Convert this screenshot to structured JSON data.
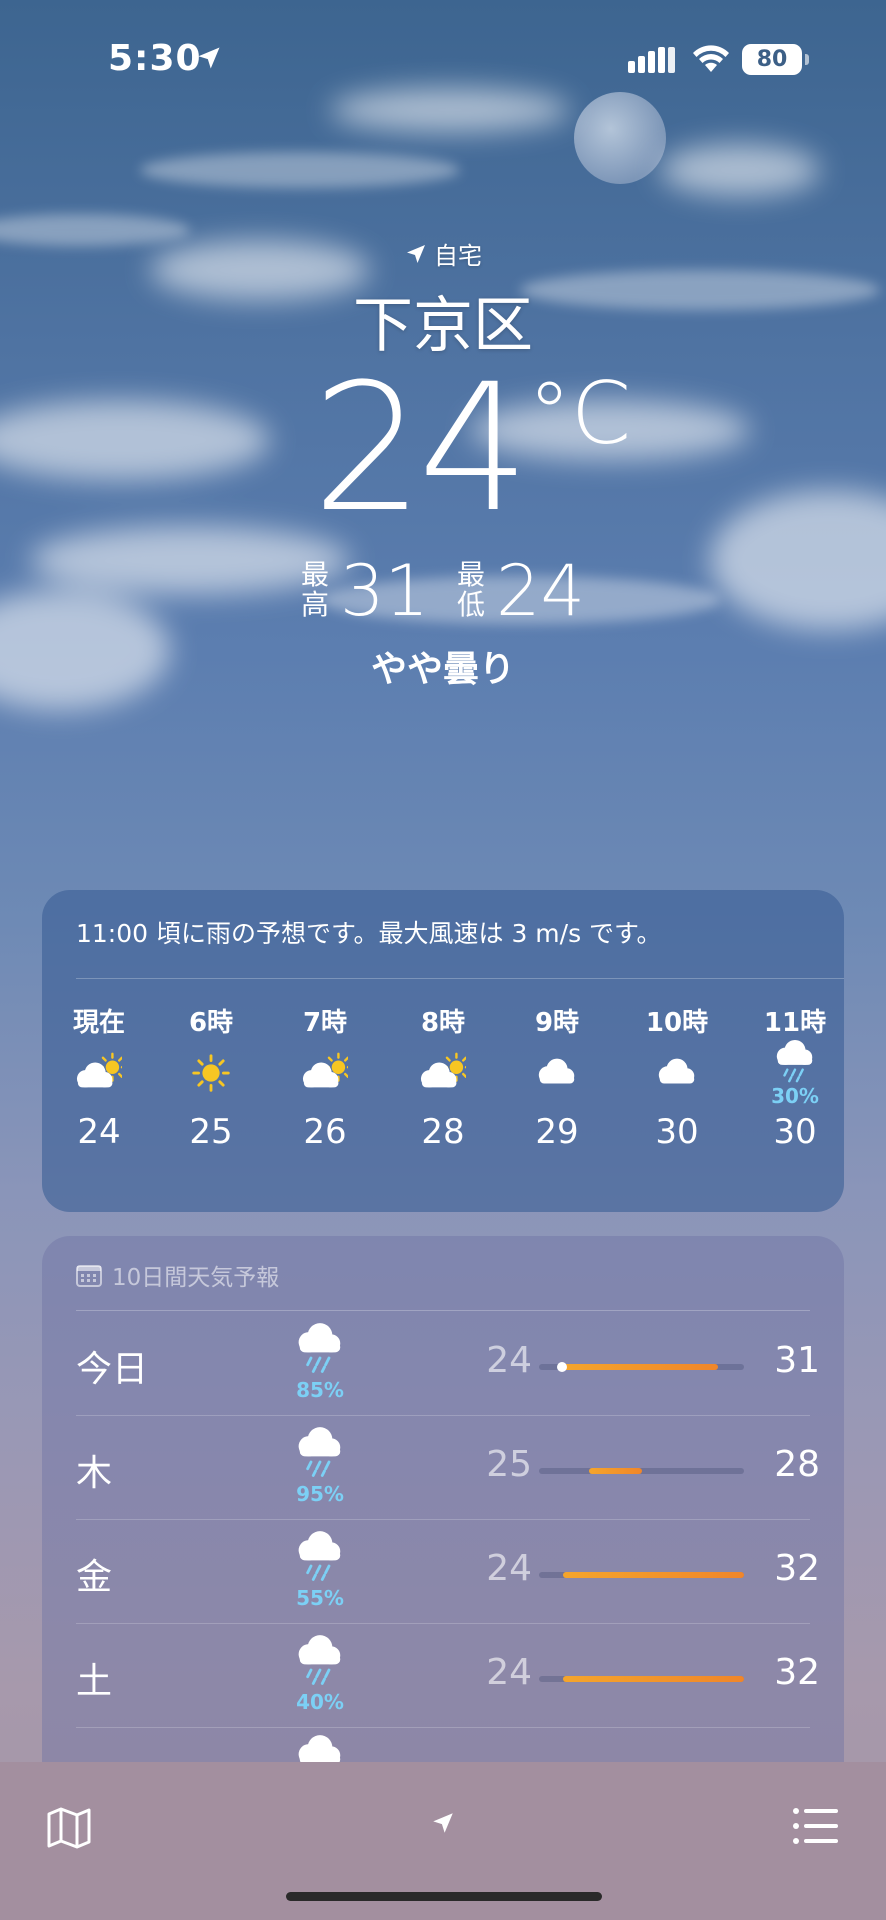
{
  "status": {
    "time": "5:30",
    "battery": "80"
  },
  "hero": {
    "location_label": "自宅",
    "city": "下京区",
    "temperature": "24",
    "unit": "°C",
    "high_label_1": "最",
    "high_label_2": "高",
    "high": "31",
    "low_label_1": "最",
    "low_label_2": "低",
    "low": "24",
    "condition": "やや曇り"
  },
  "hourly": {
    "summary": "11:00 頃に雨の予想です。最大風速は 3 m/s です。",
    "hours": [
      {
        "label": "現在",
        "icon": "partly-sunny-icon",
        "pct": "",
        "temp": "24"
      },
      {
        "label": "6時",
        "icon": "sun-icon",
        "pct": "",
        "temp": "25"
      },
      {
        "label": "7時",
        "icon": "partly-sunny-icon",
        "pct": "",
        "temp": "26"
      },
      {
        "label": "8時",
        "icon": "partly-sunny-icon",
        "pct": "",
        "temp": "28"
      },
      {
        "label": "9時",
        "icon": "cloud-icon",
        "pct": "",
        "temp": "29"
      },
      {
        "label": "10時",
        "icon": "cloud-icon",
        "pct": "",
        "temp": "30"
      },
      {
        "label": "11時",
        "icon": "rain-cloud-icon",
        "pct": "30%",
        "temp": "30"
      }
    ]
  },
  "forecast": {
    "header": "10日間天気予報",
    "range_min": 24,
    "range_max": 32,
    "days": [
      {
        "day": "今日",
        "icon": "rain-cloud-icon",
        "pct": "85%",
        "low": "24",
        "high": "31",
        "low_val": 24,
        "high_val": 31,
        "current": 24
      },
      {
        "day": "木",
        "icon": "rain-cloud-icon",
        "pct": "95%",
        "low": "25",
        "high": "28",
        "low_val": 25,
        "high_val": 28
      },
      {
        "day": "金",
        "icon": "rain-cloud-icon",
        "pct": "55%",
        "low": "24",
        "high": "32",
        "low_val": 24,
        "high_val": 32
      },
      {
        "day": "土",
        "icon": "rain-cloud-icon",
        "pct": "40%",
        "low": "24",
        "high": "32",
        "low_val": 24,
        "high_val": 32
      }
    ]
  },
  "toolbar": {
    "map": "map-icon",
    "location": "location-arrow-icon",
    "list": "list-icon"
  },
  "colors": {
    "rain_pct": "#7cd0f5",
    "bar_warm": "#f0862a",
    "sun": "#f7c623"
  }
}
